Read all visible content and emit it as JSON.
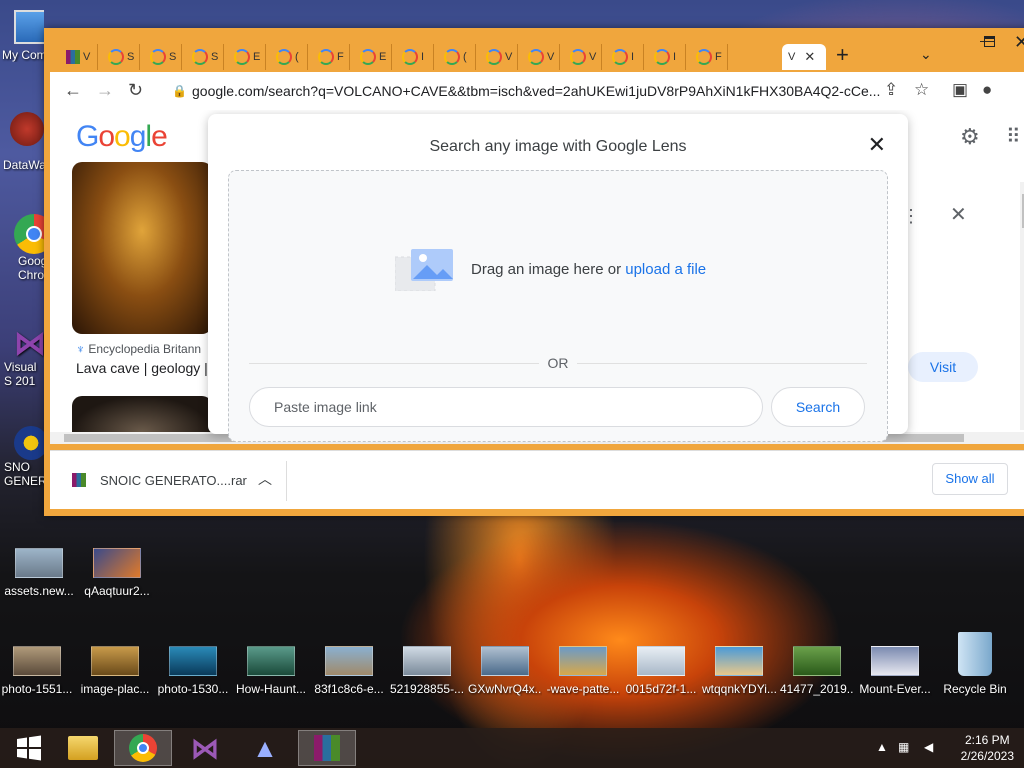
{
  "desktop": {
    "left_icons": [
      {
        "label": "My Com",
        "icon": "computer-icon"
      },
      {
        "label": "DataWa",
        "icon": "shortcut-icon"
      },
      {
        "label": "Goog Chro",
        "icon": "chrome-icon"
      },
      {
        "label": "Visual S 201",
        "icon": "visual-studio-icon"
      },
      {
        "label": "SNO GENER",
        "icon": "snoic-icon"
      }
    ],
    "row_icons": [
      {
        "label": "assets.new..."
      },
      {
        "label": "qAaqtuur2..."
      }
    ],
    "bottom_icons": [
      {
        "label": "photo-1551..."
      },
      {
        "label": "image-plac..."
      },
      {
        "label": "photo-1530..."
      },
      {
        "label": "How-Haunt..."
      },
      {
        "label": "83f1c8c6-e..."
      },
      {
        "label": "521928855-..."
      },
      {
        "label": "GXwNvrQ4x..."
      },
      {
        "label": "-wave-patte..."
      },
      {
        "label": "0015d72f-1..."
      },
      {
        "label": "wtqqnkYDYi..."
      },
      {
        "label": "41477_2019..."
      },
      {
        "label": "Mount-Ever..."
      },
      {
        "label": "Recycle Bin"
      }
    ]
  },
  "browser": {
    "tabs": [
      {
        "letter": "V"
      },
      {
        "letter": "S"
      },
      {
        "letter": "S"
      },
      {
        "letter": "S"
      },
      {
        "letter": "E"
      },
      {
        "letter": "("
      },
      {
        "letter": "F"
      },
      {
        "letter": "E"
      },
      {
        "letter": "I"
      },
      {
        "letter": "("
      },
      {
        "letter": "V"
      },
      {
        "letter": "V"
      },
      {
        "letter": "V"
      },
      {
        "letter": "I"
      },
      {
        "letter": "I"
      },
      {
        "letter": "F"
      }
    ],
    "active_tab": "V",
    "new_tab": "+",
    "url": "google.com/search?q=VOLCANO+CAVE&&tbm=isch&ved=2ahUKEwi1juDV8rP9AhXiN1kFHX30BA4Q2-cCe...",
    "google_logo": "Google",
    "result": {
      "source": "Encyclopedia Britann",
      "title": "Lava cave | geology |"
    },
    "visit_label": "Visit",
    "lens": {
      "title": "Search any image with Google Lens",
      "drag_text": "Drag an image here or ",
      "upload_link": "upload a file",
      "or_text": "OR",
      "paste_placeholder": "Paste image link",
      "search_label": "Search"
    },
    "downloads": {
      "file_name": "SNOIC GENERATO....rar",
      "show_all": "Show all"
    }
  },
  "taskbar": {
    "time": "2:16 PM",
    "date": "2/26/2023"
  }
}
